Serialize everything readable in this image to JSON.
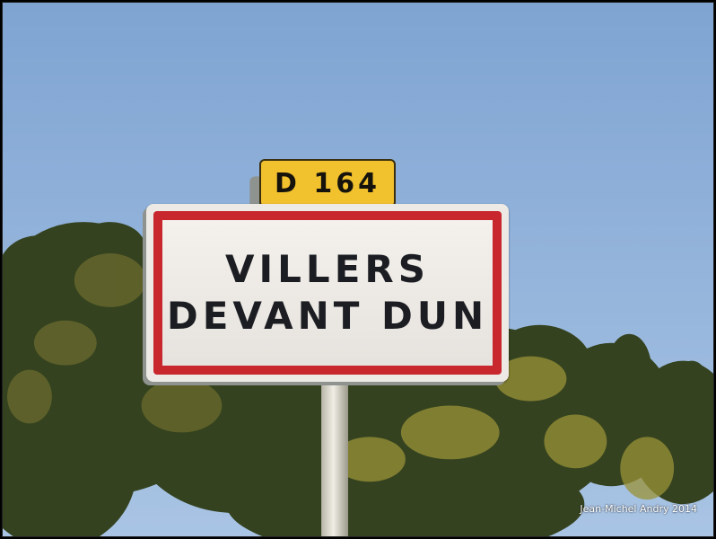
{
  "photo": {
    "route_plate": "D 164",
    "town_sign": {
      "line1": "VILLERS",
      "line2": "DEVANT DUN"
    },
    "credit": "Jean-Michel Andry 2014"
  },
  "colors": {
    "sky_top": "#7fa4d2",
    "sky_bottom": "#a9c4e4",
    "sign_border": "#c8272d",
    "plate": "#f2c12e",
    "foliage_dark": "#2f3c1e",
    "foliage_light": "#8e8a3a"
  }
}
